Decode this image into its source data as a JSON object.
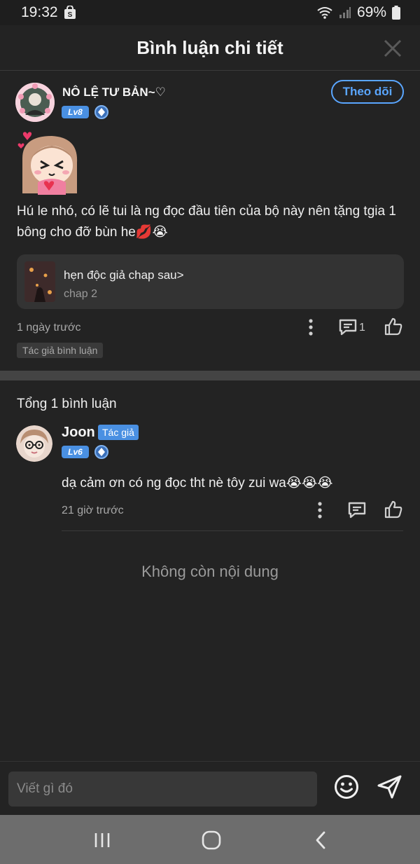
{
  "status_bar": {
    "time": "19:32",
    "battery": "69%"
  },
  "header": {
    "title": "Bình luận chi tiết",
    "close_icon": "close-icon"
  },
  "main_comment": {
    "username": "NÔ LỆ TƯ BẢN~♡",
    "level": "Lv8",
    "follow_label": "Theo dõi",
    "text": "Hú le nhó, có lẽ tui là ng đọc đầu tiên của bộ này nên tặng tgia 1 bông cho đỡ bùn he💋😭",
    "chapter_card": {
      "title": "hẹn độc giả chap sau>",
      "subtitle": "chap 2"
    },
    "time": "1 ngày trước",
    "reply_count": "1",
    "author_tag": "Tác giả bình luận"
  },
  "replies_section": {
    "total_label": "Tổng 1 bình luận",
    "reply": {
      "username": "Joon",
      "author_badge": "Tác giả",
      "level": "Lv6",
      "text": "dạ cảm ơn có ng đọc tht nè tôy zui wa😭😭😭",
      "time": "21 giờ trước"
    },
    "end_text": "Không còn nội dung"
  },
  "composer": {
    "placeholder": "Viết gì đó"
  },
  "colors": {
    "accent": "#4a90e2",
    "follow": "#5aa6ff",
    "background": "#232323"
  }
}
